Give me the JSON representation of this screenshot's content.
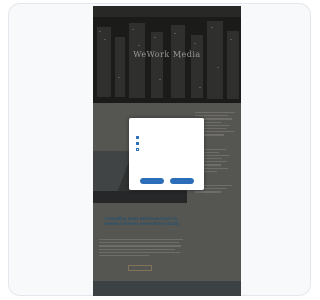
{
  "site": {
    "brand": "",
    "nav": [
      "",
      "",
      "",
      "",
      ""
    ],
    "logo": "WeWork Media",
    "tagline": ""
  },
  "sidebar": {
    "heading_1": "",
    "heading_2": "",
    "heading_3": ""
  },
  "article": {
    "title": "Consulting eines Reifenwechsels im Innenhof unseres neuen Büros (2019)",
    "read_more": ""
  },
  "cookie_modal": {
    "close_label": "",
    "title": "",
    "options": [
      "",
      "",
      ""
    ],
    "link": "",
    "preferences": "",
    "accept_selection": "",
    "accept_all": ""
  }
}
